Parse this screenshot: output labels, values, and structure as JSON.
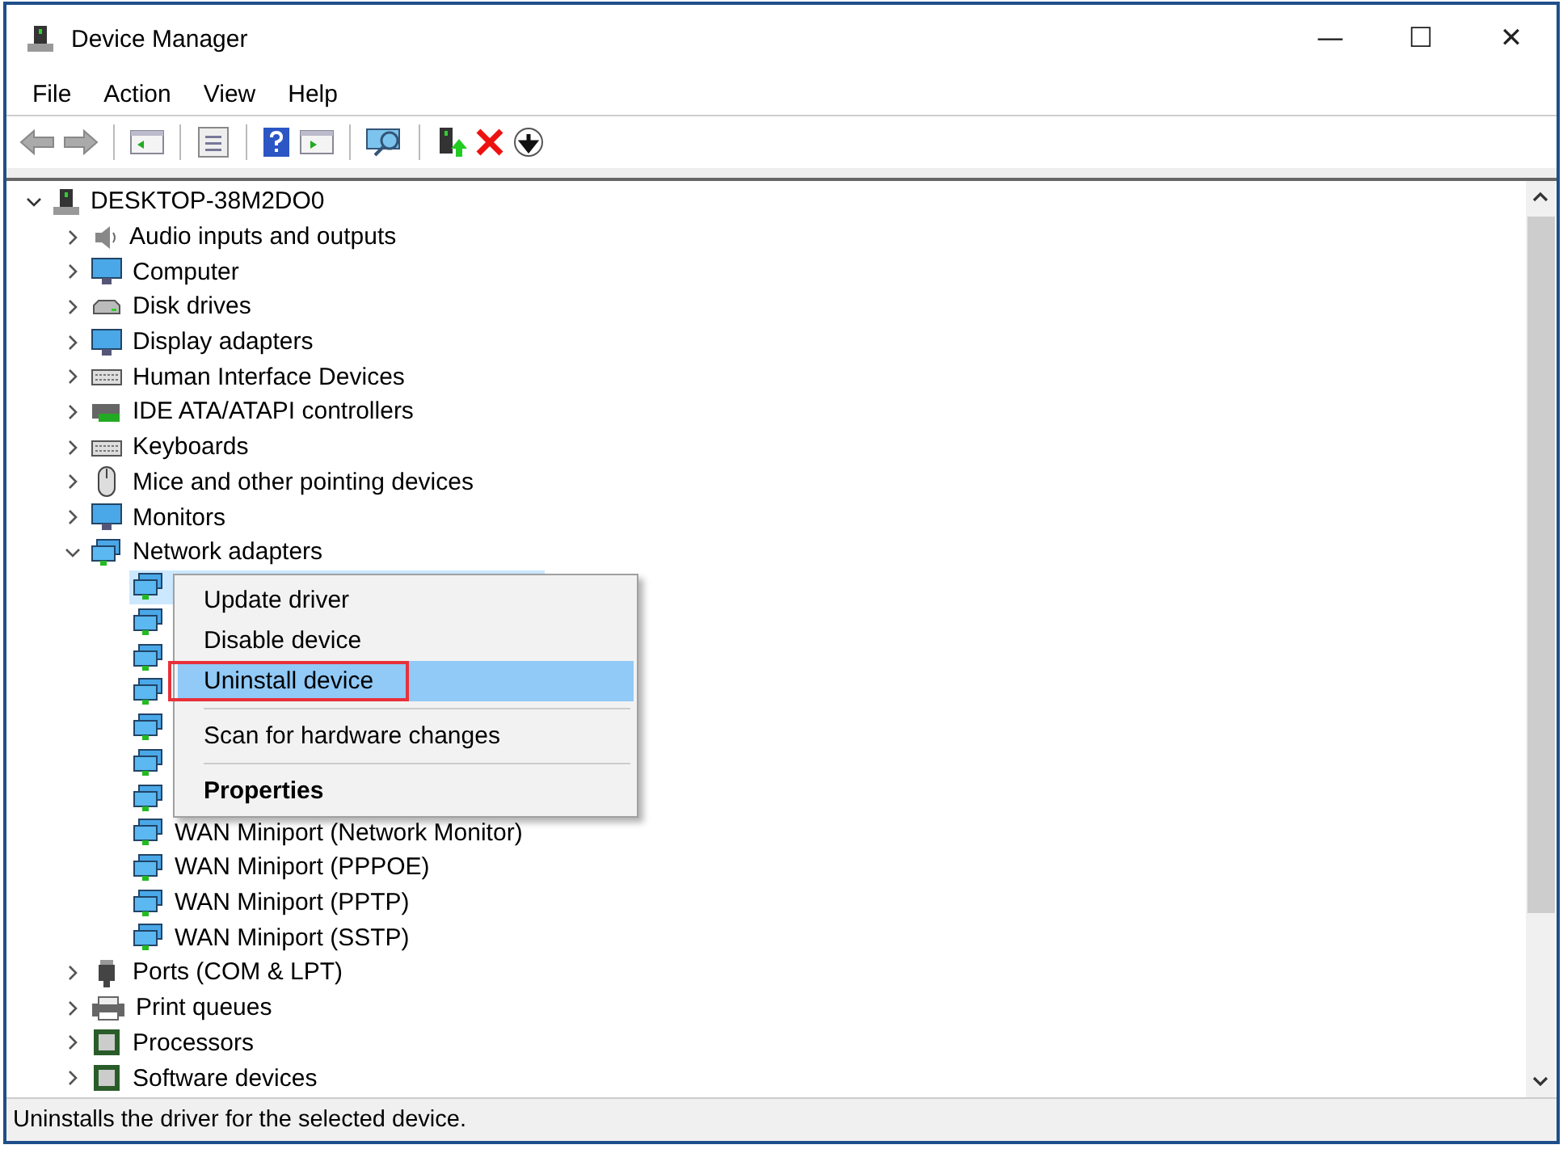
{
  "window": {
    "title": "Device Manager",
    "controls": [
      "—",
      "☐",
      "✕"
    ]
  },
  "menu": [
    "File",
    "Action",
    "View",
    "Help"
  ],
  "tree": {
    "label": "DESKTOP-38M2DO0",
    "expanded": true,
    "children": [
      {
        "label": "Audio inputs and outputs",
        "expanded": false
      },
      {
        "label": "Computer",
        "expanded": false
      },
      {
        "label": "Disk drives",
        "expanded": false
      },
      {
        "label": "Display adapters",
        "expanded": false
      },
      {
        "label": "Human Interface Devices",
        "expanded": false
      },
      {
        "label": "IDE ATA/ATAPI controllers",
        "expanded": false
      },
      {
        "label": "Keyboards",
        "expanded": false
      },
      {
        "label": "Mice and other pointing devices",
        "expanded": false
      },
      {
        "label": "Monitors",
        "expanded": false
      },
      {
        "label": "Network adapters",
        "expanded": true,
        "children": [
          {
            "selected": true
          },
          {
            "selected": false
          },
          {
            "selected": false
          },
          {
            "selected": false
          },
          {
            "selected": false
          },
          {
            "selected": false
          },
          {
            "selected": false
          },
          {
            "label": "WAN Miniport (Network Monitor)",
            "selected": false
          },
          {
            "label": "WAN Miniport (PPPOE)",
            "selected": false
          },
          {
            "label": "WAN Miniport (PPTP)",
            "selected": false
          },
          {
            "label": "WAN Miniport (SSTP)",
            "selected": false
          }
        ]
      },
      {
        "label": "Ports (COM & LPT)",
        "expanded": false
      },
      {
        "label": "Print queues",
        "expanded": false
      },
      {
        "label": "Processors",
        "expanded": false
      },
      {
        "label": "Software devices",
        "expanded": false
      }
    ]
  },
  "context_menu": [
    {
      "kind": "item",
      "label": "Update driver",
      "selected": false,
      "bold": false,
      "outlined": false
    },
    {
      "kind": "item",
      "label": "Disable device",
      "selected": false,
      "bold": false,
      "outlined": false
    },
    {
      "kind": "item",
      "label": "Uninstall device",
      "selected": true,
      "bold": false,
      "outlined": true
    },
    {
      "kind": "separator"
    },
    {
      "kind": "item",
      "label": "Scan for hardware changes",
      "selected": false,
      "bold": false,
      "outlined": false
    },
    {
      "kind": "separator"
    },
    {
      "kind": "item",
      "label": "Properties",
      "selected": false,
      "bold": true,
      "outlined": false
    }
  ],
  "status_bar": "Uninstalls the driver for the selected device."
}
